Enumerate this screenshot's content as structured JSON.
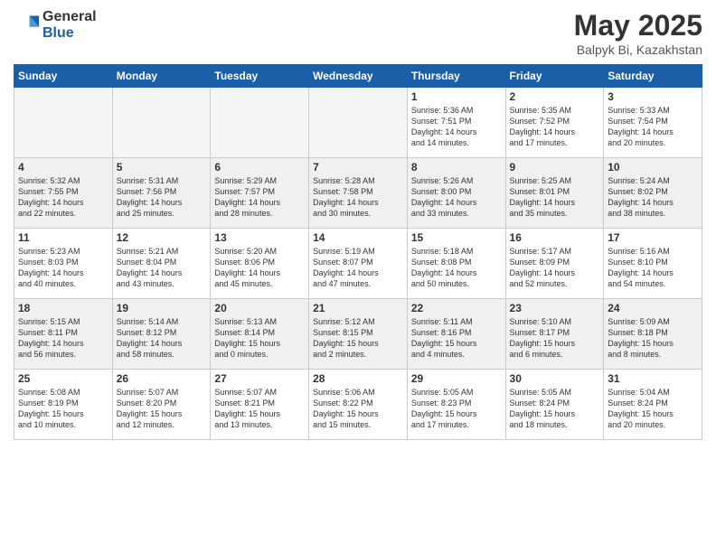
{
  "header": {
    "logo_general": "General",
    "logo_blue": "Blue",
    "month_title": "May 2025",
    "location": "Balpyk Bi, Kazakhstan"
  },
  "weekdays": [
    "Sunday",
    "Monday",
    "Tuesday",
    "Wednesday",
    "Thursday",
    "Friday",
    "Saturday"
  ],
  "weeks": [
    [
      {
        "day": "",
        "info": ""
      },
      {
        "day": "",
        "info": ""
      },
      {
        "day": "",
        "info": ""
      },
      {
        "day": "",
        "info": ""
      },
      {
        "day": "1",
        "info": "Sunrise: 5:36 AM\nSunset: 7:51 PM\nDaylight: 14 hours\nand 14 minutes."
      },
      {
        "day": "2",
        "info": "Sunrise: 5:35 AM\nSunset: 7:52 PM\nDaylight: 14 hours\nand 17 minutes."
      },
      {
        "day": "3",
        "info": "Sunrise: 5:33 AM\nSunset: 7:54 PM\nDaylight: 14 hours\nand 20 minutes."
      }
    ],
    [
      {
        "day": "4",
        "info": "Sunrise: 5:32 AM\nSunset: 7:55 PM\nDaylight: 14 hours\nand 22 minutes."
      },
      {
        "day": "5",
        "info": "Sunrise: 5:31 AM\nSunset: 7:56 PM\nDaylight: 14 hours\nand 25 minutes."
      },
      {
        "day": "6",
        "info": "Sunrise: 5:29 AM\nSunset: 7:57 PM\nDaylight: 14 hours\nand 28 minutes."
      },
      {
        "day": "7",
        "info": "Sunrise: 5:28 AM\nSunset: 7:58 PM\nDaylight: 14 hours\nand 30 minutes."
      },
      {
        "day": "8",
        "info": "Sunrise: 5:26 AM\nSunset: 8:00 PM\nDaylight: 14 hours\nand 33 minutes."
      },
      {
        "day": "9",
        "info": "Sunrise: 5:25 AM\nSunset: 8:01 PM\nDaylight: 14 hours\nand 35 minutes."
      },
      {
        "day": "10",
        "info": "Sunrise: 5:24 AM\nSunset: 8:02 PM\nDaylight: 14 hours\nand 38 minutes."
      }
    ],
    [
      {
        "day": "11",
        "info": "Sunrise: 5:23 AM\nSunset: 8:03 PM\nDaylight: 14 hours\nand 40 minutes."
      },
      {
        "day": "12",
        "info": "Sunrise: 5:21 AM\nSunset: 8:04 PM\nDaylight: 14 hours\nand 43 minutes."
      },
      {
        "day": "13",
        "info": "Sunrise: 5:20 AM\nSunset: 8:06 PM\nDaylight: 14 hours\nand 45 minutes."
      },
      {
        "day": "14",
        "info": "Sunrise: 5:19 AM\nSunset: 8:07 PM\nDaylight: 14 hours\nand 47 minutes."
      },
      {
        "day": "15",
        "info": "Sunrise: 5:18 AM\nSunset: 8:08 PM\nDaylight: 14 hours\nand 50 minutes."
      },
      {
        "day": "16",
        "info": "Sunrise: 5:17 AM\nSunset: 8:09 PM\nDaylight: 14 hours\nand 52 minutes."
      },
      {
        "day": "17",
        "info": "Sunrise: 5:16 AM\nSunset: 8:10 PM\nDaylight: 14 hours\nand 54 minutes."
      }
    ],
    [
      {
        "day": "18",
        "info": "Sunrise: 5:15 AM\nSunset: 8:11 PM\nDaylight: 14 hours\nand 56 minutes."
      },
      {
        "day": "19",
        "info": "Sunrise: 5:14 AM\nSunset: 8:12 PM\nDaylight: 14 hours\nand 58 minutes."
      },
      {
        "day": "20",
        "info": "Sunrise: 5:13 AM\nSunset: 8:14 PM\nDaylight: 15 hours\nand 0 minutes."
      },
      {
        "day": "21",
        "info": "Sunrise: 5:12 AM\nSunset: 8:15 PM\nDaylight: 15 hours\nand 2 minutes."
      },
      {
        "day": "22",
        "info": "Sunrise: 5:11 AM\nSunset: 8:16 PM\nDaylight: 15 hours\nand 4 minutes."
      },
      {
        "day": "23",
        "info": "Sunrise: 5:10 AM\nSunset: 8:17 PM\nDaylight: 15 hours\nand 6 minutes."
      },
      {
        "day": "24",
        "info": "Sunrise: 5:09 AM\nSunset: 8:18 PM\nDaylight: 15 hours\nand 8 minutes."
      }
    ],
    [
      {
        "day": "25",
        "info": "Sunrise: 5:08 AM\nSunset: 8:19 PM\nDaylight: 15 hours\nand 10 minutes."
      },
      {
        "day": "26",
        "info": "Sunrise: 5:07 AM\nSunset: 8:20 PM\nDaylight: 15 hours\nand 12 minutes."
      },
      {
        "day": "27",
        "info": "Sunrise: 5:07 AM\nSunset: 8:21 PM\nDaylight: 15 hours\nand 13 minutes."
      },
      {
        "day": "28",
        "info": "Sunrise: 5:06 AM\nSunset: 8:22 PM\nDaylight: 15 hours\nand 15 minutes."
      },
      {
        "day": "29",
        "info": "Sunrise: 5:05 AM\nSunset: 8:23 PM\nDaylight: 15 hours\nand 17 minutes."
      },
      {
        "day": "30",
        "info": "Sunrise: 5:05 AM\nSunset: 8:24 PM\nDaylight: 15 hours\nand 18 minutes."
      },
      {
        "day": "31",
        "info": "Sunrise: 5:04 AM\nSunset: 8:24 PM\nDaylight: 15 hours\nand 20 minutes."
      }
    ]
  ]
}
